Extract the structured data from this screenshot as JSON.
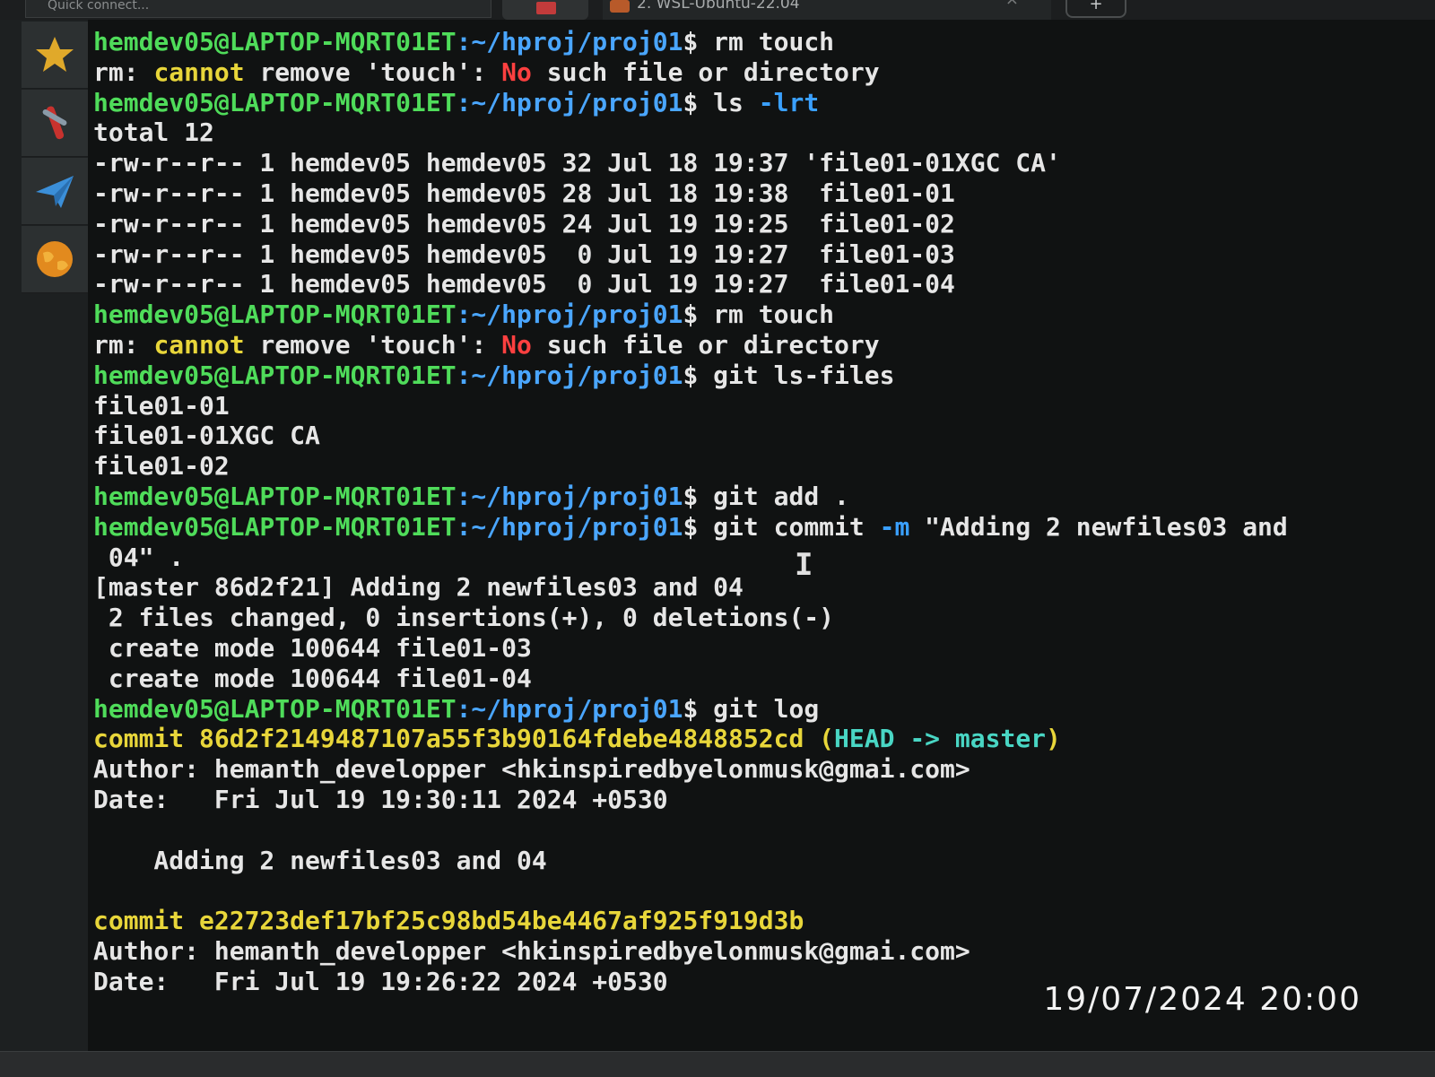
{
  "tabbar": {
    "quick_connect": "Quick connect...",
    "active_tab": "2. WSL-Ubuntu-22.04",
    "close_glyph": "×",
    "new_tab_glyph": "+"
  },
  "launcher": {
    "items": [
      {
        "icon": "star-icon"
      },
      {
        "icon": "tools-icon"
      },
      {
        "icon": "send-icon"
      },
      {
        "icon": "globe-icon"
      }
    ]
  },
  "terminal": {
    "prompt_user": "hemdev05@LAPTOP-MQRT01ET",
    "prompt_path": ":~/hproj/proj01",
    "prompt_char": "$ ",
    "lines": [
      {
        "kind": "prompt",
        "cmd": "rm touch"
      },
      {
        "kind": "err",
        "a": "rm: ",
        "b": "cannot",
        "c": " remove 'touch': ",
        "d": "No",
        "e": " such file or directory"
      },
      {
        "kind": "prompt",
        "cmd": "ls ",
        "flag": "-lrt"
      },
      {
        "kind": "out",
        "text": "total 12"
      },
      {
        "kind": "out",
        "text": "-rw-r--r-- 1 hemdev05 hemdev05 32 Jul 18 19:37 'file01-01XGC CA'"
      },
      {
        "kind": "out",
        "text": "-rw-r--r-- 1 hemdev05 hemdev05 28 Jul 18 19:38  file01-01"
      },
      {
        "kind": "out",
        "text": "-rw-r--r-- 1 hemdev05 hemdev05 24 Jul 19 19:25  file01-02"
      },
      {
        "kind": "out",
        "text": "-rw-r--r-- 1 hemdev05 hemdev05  0 Jul 19 19:27  file01-03"
      },
      {
        "kind": "out",
        "text": "-rw-r--r-- 1 hemdev05 hemdev05  0 Jul 19 19:27  file01-04"
      },
      {
        "kind": "prompt",
        "cmd": "rm touch"
      },
      {
        "kind": "err",
        "a": "rm: ",
        "b": "cannot",
        "c": " remove 'touch': ",
        "d": "No",
        "e": " such file or directory"
      },
      {
        "kind": "prompt",
        "cmd": "git ls-files"
      },
      {
        "kind": "out",
        "text": "file01-01"
      },
      {
        "kind": "out",
        "text": "file01-01XGC CA"
      },
      {
        "kind": "out",
        "text": "file01-02"
      },
      {
        "kind": "prompt",
        "cmd": "git add ."
      },
      {
        "kind": "prompt",
        "cmd": "git commit ",
        "flag": "-m",
        "rest": " \"Adding 2 newfiles03 and"
      },
      {
        "kind": "out",
        "text": " 04\" ."
      },
      {
        "kind": "out",
        "text": "[master 86d2f21] Adding 2 newfiles03 and 04"
      },
      {
        "kind": "out",
        "text": " 2 files changed, 0 insertions(+), 0 deletions(-)"
      },
      {
        "kind": "out",
        "text": " create mode 100644 file01-03"
      },
      {
        "kind": "out",
        "text": " create mode 100644 file01-04"
      },
      {
        "kind": "prompt",
        "cmd": "git log"
      },
      {
        "kind": "commit",
        "hash": "commit 86d2f2149487107a55f3b90164fdebe4848852cd",
        "open": " (",
        "head": "HEAD -> master",
        "close": ")"
      },
      {
        "kind": "out",
        "text": "Author: hemanth_developper <hkinspiredbyelonmusk@gmai.com>"
      },
      {
        "kind": "out",
        "text": "Date:   Fri Jul 19 19:30:11 2024 +0530"
      },
      {
        "kind": "blank",
        "text": ""
      },
      {
        "kind": "out",
        "text": "    Adding 2 newfiles03 and 04"
      },
      {
        "kind": "blank",
        "text": ""
      },
      {
        "kind": "commit2",
        "hash": "commit e22723def17bf25c98bd54be4467af925f919d3b"
      },
      {
        "kind": "out",
        "text": "Author: hemanth_developper <hkinspiredbyelonmusk@gmai.com>"
      },
      {
        "kind": "out",
        "text": "Date:   Fri Jul 19 19:26:22 2024 +0530"
      }
    ]
  },
  "text_cursor": "I",
  "photo_timestamp": "19/07/2024 20:00",
  "colors": {
    "prompt_user": "#4fdc5a",
    "prompt_path": "#4aa6ff",
    "warning": "#e8d63a",
    "error": "#ff4040"
  }
}
